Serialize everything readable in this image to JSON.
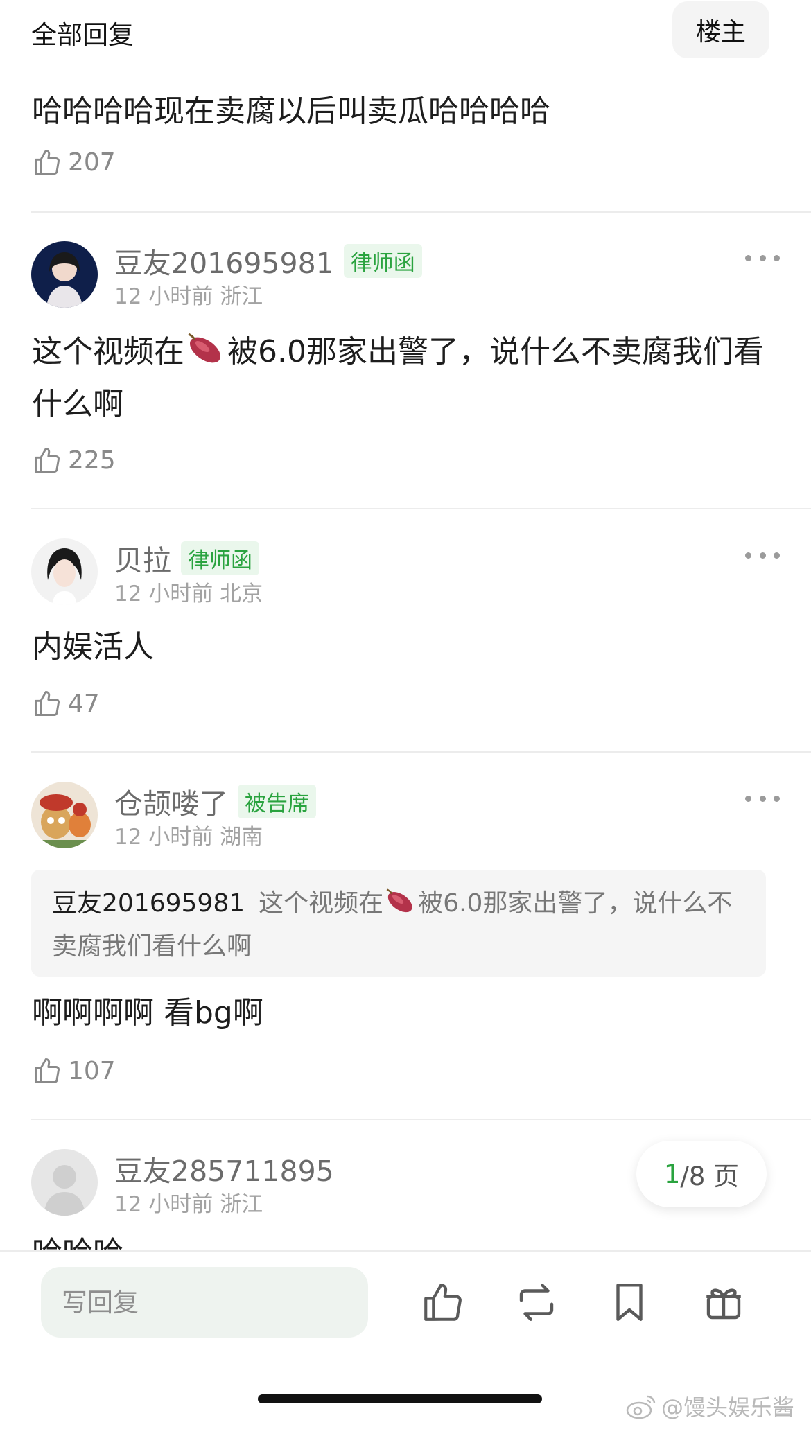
{
  "header": {
    "title": "全部回复",
    "op_button": "楼主"
  },
  "top_reply": {
    "text": "哈哈哈哈现在卖腐以后叫卖瓜哈哈哈哈",
    "likes": "207"
  },
  "comments": [
    {
      "user": "豆友201695981",
      "badge": "律师函",
      "time": "12 小时前",
      "location": "浙江",
      "text_before": "这个视频在",
      "emoji": "sweet-potato",
      "text_after": "被6.0那家出警了，说什么不卖腐我们看什么啊",
      "likes": "225"
    },
    {
      "user": "贝拉",
      "badge": "律师函",
      "time": "12 小时前",
      "location": "北京",
      "text": "内娱活人",
      "likes": "47"
    },
    {
      "user": "仓颉喽了",
      "badge": "被告席",
      "time": "12 小时前",
      "location": "湖南",
      "quote_user": "豆友201695981",
      "quote_before": "这个视频在",
      "quote_after": "被6.0那家出警了，说什么不卖腐我们看什么啊",
      "text": "啊啊啊啊  看bg啊",
      "likes": "107"
    },
    {
      "user": "豆友285711895",
      "time": "12 小时前",
      "location": "浙江",
      "text": "哈哈哈"
    }
  ],
  "pagination": {
    "current": "1",
    "total": "/8 页"
  },
  "bottom_bar": {
    "reply_placeholder": "写回复"
  },
  "watermark": "@馒头娱乐酱",
  "colors": {
    "accent": "#2aa33f",
    "badge_bg": "#eaf7ec"
  }
}
